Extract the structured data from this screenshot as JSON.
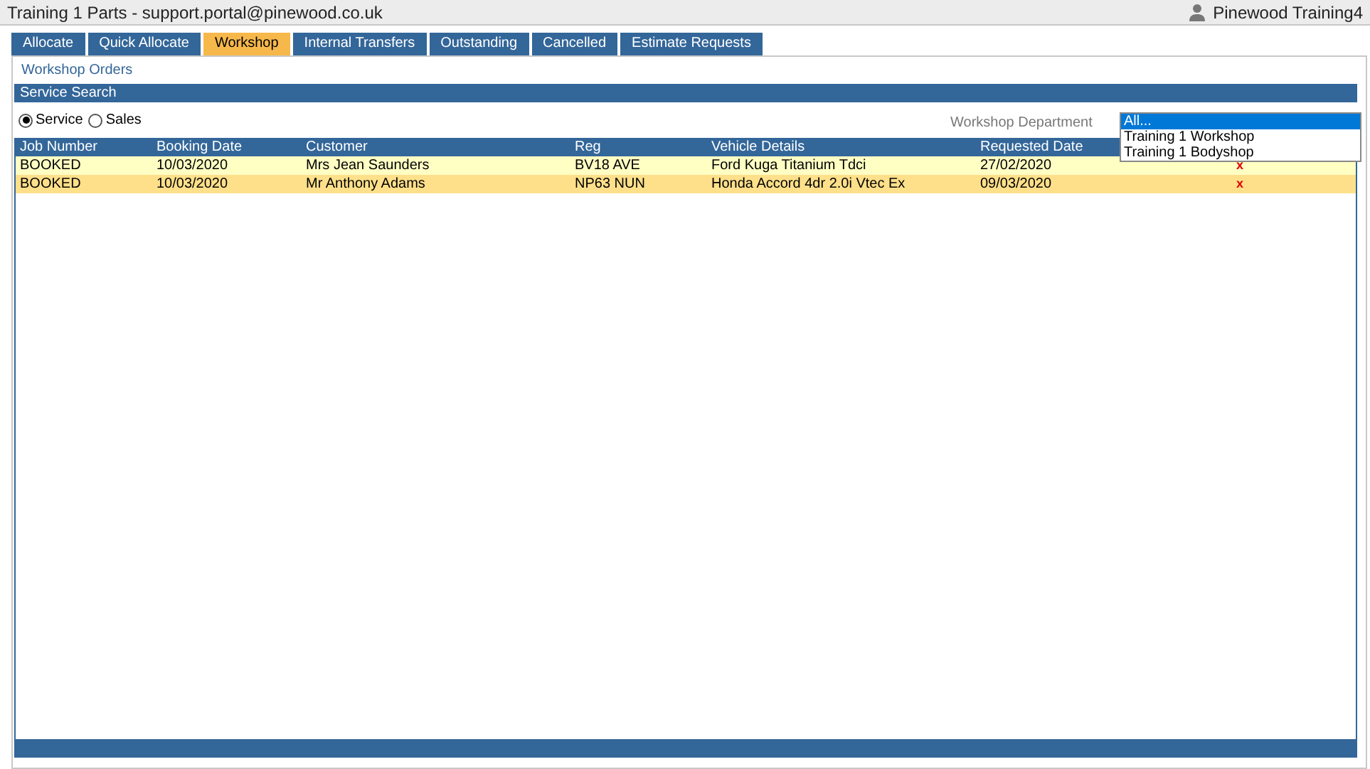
{
  "window": {
    "title": "Training 1 Parts - support.portal@pinewood.co.uk",
    "user": "Pinewood Training4"
  },
  "tabs": [
    {
      "label": "Allocate",
      "selected": false
    },
    {
      "label": "Quick Allocate",
      "selected": false
    },
    {
      "label": "Workshop",
      "selected": true
    },
    {
      "label": "Internal Transfers",
      "selected": false
    },
    {
      "label": "Outstanding",
      "selected": false
    },
    {
      "label": "Cancelled",
      "selected": false
    },
    {
      "label": "Estimate Requests",
      "selected": false
    }
  ],
  "page_title": "Workshop Orders",
  "section_title": "Service Search",
  "radios": [
    {
      "label": "Service",
      "selected": true
    },
    {
      "label": "Sales",
      "selected": false
    }
  ],
  "department": {
    "label": "Workshop Department",
    "options": [
      {
        "label": "All...",
        "selected": true
      },
      {
        "label": "Training 1 Workshop",
        "selected": false
      },
      {
        "label": "Training 1 Bodyshop",
        "selected": false
      }
    ]
  },
  "table": {
    "columns": [
      "Job Number",
      "Booking Date",
      "Customer",
      "Reg",
      "Vehicle Details",
      "Requested Date"
    ],
    "rows": [
      {
        "cells": [
          "BOOKED",
          "10/03/2020",
          "Mrs Jean Saunders",
          "BV18 AVE",
          "Ford Kuga Titanium Tdci",
          "27/02/2020"
        ],
        "selected": false,
        "delete": "x"
      },
      {
        "cells": [
          "BOOKED",
          "10/03/2020",
          "Mr Anthony Adams",
          "NP63 NUN",
          "Honda Accord 4dr 2.0i Vtec Ex",
          "09/03/2020"
        ],
        "selected": true,
        "delete": "x"
      }
    ]
  }
}
